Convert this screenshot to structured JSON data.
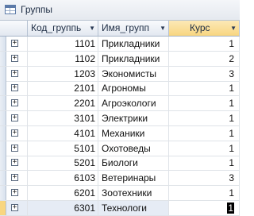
{
  "window": {
    "title": "Группы"
  },
  "table": {
    "columns": [
      {
        "label": "Код_группь"
      },
      {
        "label": "Имя_групп"
      },
      {
        "label": "Курс"
      }
    ],
    "rows": [
      {
        "code": "1101",
        "name": "Прикладники",
        "course": "1"
      },
      {
        "code": "1102",
        "name": "Прикладники",
        "course": "2"
      },
      {
        "code": "1203",
        "name": "Экономисты",
        "course": "3"
      },
      {
        "code": "2101",
        "name": "Агрономы",
        "course": "1"
      },
      {
        "code": "2201",
        "name": "Агроэкологи",
        "course": "1"
      },
      {
        "code": "3101",
        "name": "Электрики",
        "course": "1"
      },
      {
        "code": "4101",
        "name": "Механики",
        "course": "1"
      },
      {
        "code": "5101",
        "name": "Охотоведы",
        "course": "1"
      },
      {
        "code": "5201",
        "name": "Биологи",
        "course": "1"
      },
      {
        "code": "6103",
        "name": "Ветеринары",
        "course": "3"
      },
      {
        "code": "6201",
        "name": "Зоотехники",
        "course": "1"
      },
      {
        "code": "6301",
        "name": "Технологи",
        "course": "1"
      }
    ],
    "selected_row": 11,
    "expand_glyph": "+",
    "sort_glyph": "▼"
  }
}
